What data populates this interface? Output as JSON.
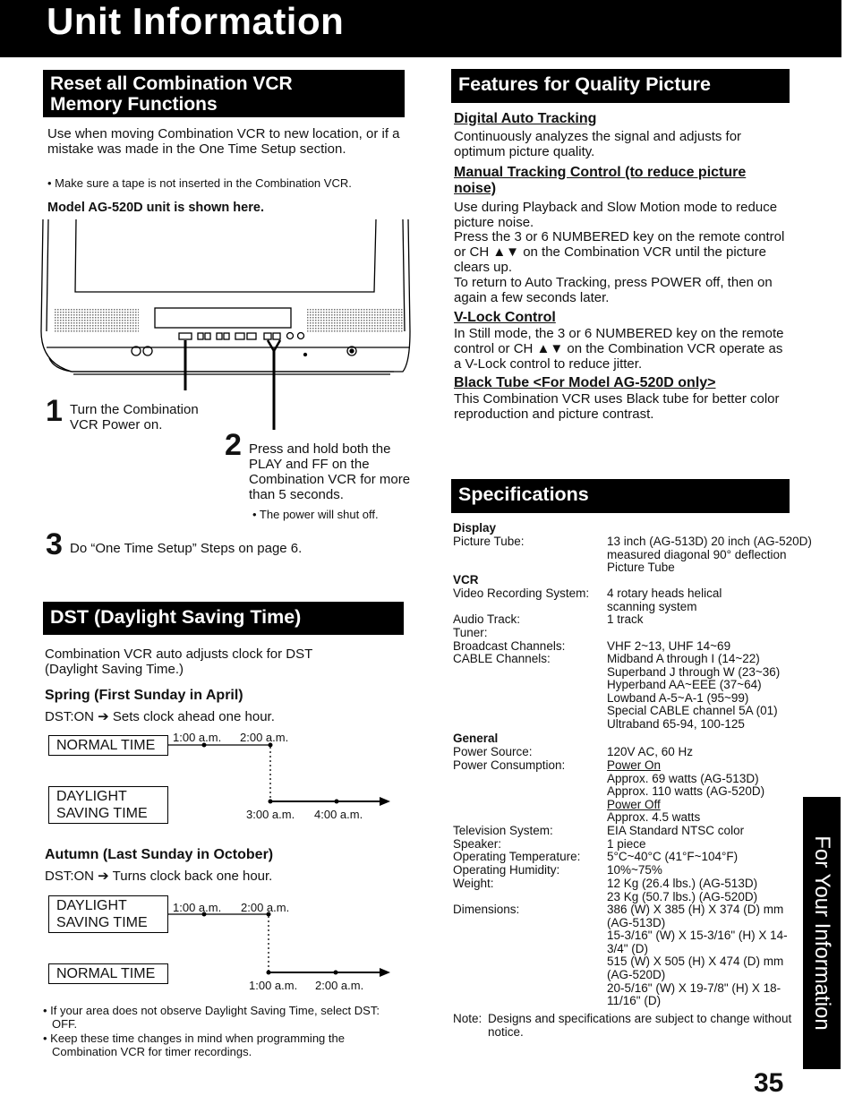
{
  "page": {
    "title": "Unit Information",
    "page_number": "35",
    "side_tab": "For Your Information"
  },
  "reset": {
    "heading_line1": "Reset all Combination VCR",
    "heading_line2": "Memory Functions",
    "intro": "Use when moving Combination VCR to new location, or if a mistake was made in the One Time Setup section.",
    "note": "• Make sure a tape is not inserted in the Combination VCR.",
    "model_caption": "Model AG-520D unit is shown here.",
    "steps": [
      {
        "num": "1",
        "text": "Turn the Combination VCR Power on."
      },
      {
        "num": "2",
        "text": "Press and hold both the PLAY and FF on the Combination VCR for more than 5 seconds.",
        "note": "• The power will shut off."
      },
      {
        "num": "3",
        "text": "Do “One Time Setup” Steps on page 6."
      }
    ]
  },
  "dst": {
    "heading": "DST (Daylight Saving Time)",
    "intro": "Combination VCR auto adjusts clock for DST (Daylight Saving Time.)",
    "spring": {
      "title": "Spring (First Sunday in April)",
      "desc": "DST:ON ➔ Sets clock ahead one hour.",
      "box_top": "NORMAL TIME",
      "box_bottom_1": "DAYLIGHT",
      "box_bottom_2": "SAVING TIME",
      "top_times": [
        "1:00 a.m.",
        "2:00 a.m."
      ],
      "bottom_times": [
        "3:00 a.m.",
        "4:00 a.m."
      ]
    },
    "autumn": {
      "title": "Autumn (Last Sunday in October)",
      "desc": "DST:ON ➔ Turns clock back one hour.",
      "box_top_1": "DAYLIGHT",
      "box_top_2": "SAVING TIME",
      "box_bottom": "NORMAL TIME",
      "top_times": [
        "1:00 a.m.",
        "2:00 a.m."
      ],
      "bottom_times": [
        "1:00 a.m.",
        "2:00 a.m."
      ]
    },
    "notes": [
      "• If your area does not observe Daylight Saving Time, select DST: OFF.",
      "• Keep these time changes in mind when programming the Combination VCR for timer recordings."
    ]
  },
  "features": {
    "heading": "Features for Quality Picture",
    "items": [
      {
        "title": "Digital Auto Tracking",
        "paras": [
          "Continuously analyzes the signal and adjusts for optimum picture quality."
        ]
      },
      {
        "title": "Manual Tracking Control (to reduce picture noise)",
        "paras": [
          "Use during Playback and Slow Motion mode to reduce picture noise.",
          "Press the 3 or 6 NUMBERED key on the remote control or CH ▲▼ on the Combination VCR until the picture clears up.",
          "To return to Auto Tracking, press POWER off, then on again a few seconds later."
        ]
      },
      {
        "title": "V-Lock Control",
        "paras": [
          "In Still mode, the 3 or 6 NUMBERED key on the remote control or CH ▲▼ on the Combination VCR operate as a V-Lock control to reduce jitter."
        ]
      },
      {
        "title": "Black Tube <For Model AG-520D only>",
        "paras": [
          "This Combination VCR uses Black tube for better color reproduction and picture contrast."
        ]
      }
    ]
  },
  "specs": {
    "heading": "Specifications",
    "display_cat": "Display",
    "picture_tube_label": "Picture Tube:",
    "picture_tube_val": "13 inch (AG-513D) 20 inch (AG-520D) measured diagonal 90° deflection Picture Tube",
    "vcr_cat": "VCR",
    "video_rec_label": "Video Recording System:",
    "video_rec_val": "4 rotary heads helical scanning system",
    "audio_label": "Audio Track:",
    "audio_val": "1 track",
    "tuner_label": "Tuner:",
    "broadcast_label": "Broadcast Channels:",
    "broadcast_val": "VHF 2~13, UHF 14~69",
    "cable_label": "CABLE Channels:",
    "cable_vals": [
      "Midband A through I (14~22)",
      "Superband J through W (23~36)",
      "Hyperband AA~EEE (37~64)",
      "Lowband A-5~A-1 (95~99)",
      "Special CABLE channel 5A (01)",
      "Ultraband 65-94, 100-125"
    ],
    "general_cat": "General",
    "power_source_label": "Power Source:",
    "power_source_val": "120V AC, 60 Hz",
    "power_cons_label": "Power Consumption:",
    "power_on": "Power On",
    "power_on_vals": [
      "Approx. 69 watts (AG-513D)",
      "Approx. 110 watts (AG-520D)"
    ],
    "power_off": "Power Off",
    "power_off_val": "Approx. 4.5 watts",
    "tv_label": "Television System:",
    "tv_val": "EIA Standard NTSC color",
    "speaker_label": "Speaker:",
    "speaker_val": "1 piece",
    "temp_label": "Operating Temperature:",
    "temp_val": "5°C~40°C (41°F~104°F)",
    "humidity_label": "Operating Humidity:",
    "humidity_val": "10%~75%",
    "weight_label": "Weight:",
    "weight_vals": [
      "12 Kg (26.4 lbs.) (AG-513D)",
      "23 Kg (50.7 lbs.) (AG-520D)"
    ],
    "dim_label": "Dimensions:",
    "dim_vals": [
      "386 (W) X 385 (H) X 374 (D) mm (AG-513D)",
      "15-3/16\" (W) X 15-3/16\" (H) X 14-3/4\" (D)",
      "515 (W) X 505 (H) X 474 (D) mm (AG-520D)",
      "20-5/16\" (W) X 19-7/8\" (H) X 18-11/16\" (D)"
    ],
    "note_label": "Note:",
    "note_val": "Designs and specifications are subject to change without notice."
  }
}
